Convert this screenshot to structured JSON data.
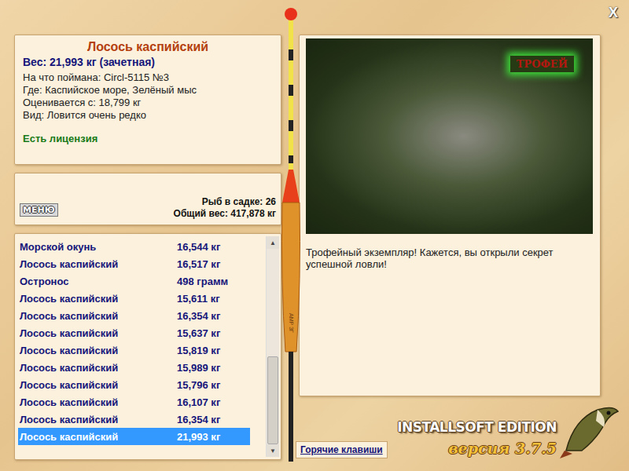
{
  "window": {
    "close": "X"
  },
  "fish": {
    "name": "Лосось каспийский",
    "weight": "Вес: 21,993 кг (зачетная)",
    "details": [
      "На что поймана: Circl-5115 №3",
      "Где: Каспийское море, Зелёный мыс",
      "Оценивается с: 18,799 кг",
      "Вид: Ловится очень редко"
    ],
    "license": "Есть лицензия"
  },
  "menu_button": "МЕНЮ",
  "keepnet": {
    "count": "Рыб в садке: 26",
    "total": "Общий вес: 417,878 кг"
  },
  "catch_list": [
    {
      "name": "Морской окунь",
      "weight": "16,544 кг",
      "selected": false
    },
    {
      "name": "Лосось каспийский",
      "weight": "16,517 кг",
      "selected": false
    },
    {
      "name": "Остронос",
      "weight": "498 грамм",
      "selected": false
    },
    {
      "name": "Лосось каспийский",
      "weight": "15,611 кг",
      "selected": false
    },
    {
      "name": "Лосось каспийский",
      "weight": "16,354 кг",
      "selected": false
    },
    {
      "name": "Лосось каспийский",
      "weight": "15,637 кг",
      "selected": false
    },
    {
      "name": "Лосось каспийский",
      "weight": "15,819 кг",
      "selected": false
    },
    {
      "name": "Лосось каспийский",
      "weight": "15,989 кг",
      "selected": false
    },
    {
      "name": "Лосось каспийский",
      "weight": "15,796 кг",
      "selected": false
    },
    {
      "name": "Лосось каспийский",
      "weight": "16,107 кг",
      "selected": false
    },
    {
      "name": "Лосось каспийский",
      "weight": "16,354 кг",
      "selected": false
    },
    {
      "name": "Лосось каспийский",
      "weight": "21,993 кг",
      "selected": true
    }
  ],
  "scrollbar": {
    "up": "▲",
    "down": "▼",
    "thumb_start": 0.55,
    "thumb_end": 1
  },
  "float": {
    "label": "АМР 3Г"
  },
  "photo": {
    "badge": "ТРОФЕЙ"
  },
  "message": "Трофейный экземпляр! Кажется, вы открыли секрет успешной ловли!",
  "hotkeys_button": "Горячие клавиши",
  "logo": {
    "brand": "INSTALLSOFT EDITION",
    "version": "версия 3.7.5"
  }
}
